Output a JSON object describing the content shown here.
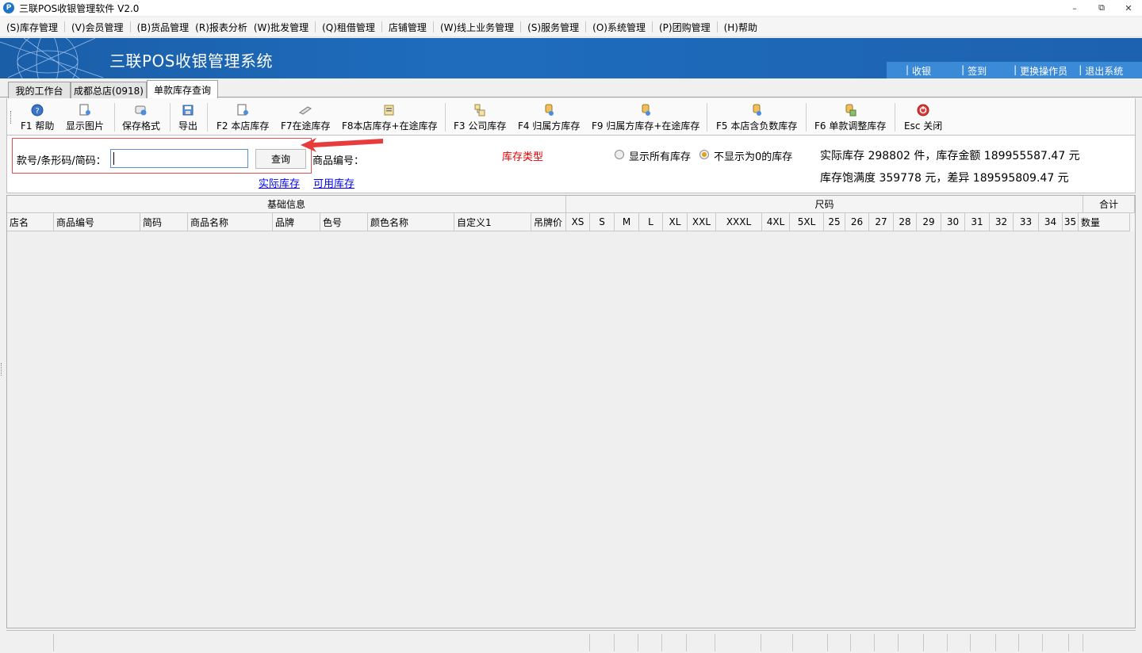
{
  "window": {
    "title": "三联POS收银管理软件 V2.0",
    "app_icon_letter": "P",
    "controls": {
      "minimize": "–",
      "restore": "⧉",
      "close": "✕"
    }
  },
  "menu": [
    "(S)库存管理",
    "(V)会员管理",
    "(B)货品管理",
    "(R)报表分析",
    "(W)批发管理",
    "(Q)租借管理",
    "店铺管理",
    "(W)线上业务管理",
    "(S)服务管理",
    "(O)系统管理",
    "(P)团购管理",
    "(H)帮助"
  ],
  "banner": {
    "title": "三联POS收银管理系统",
    "links": [
      "收银",
      "签到",
      "更换操作员",
      "退出系统"
    ]
  },
  "tabs": [
    "我的工作台",
    "成都总店(0918)",
    "单款库存查询"
  ],
  "toolbar": [
    {
      "label": "F1 帮助",
      "icon": "help-icon"
    },
    {
      "label": "显示图片",
      "icon": "image-icon"
    },
    {
      "label": "保存格式",
      "icon": "save-format-icon"
    },
    {
      "label": "导出",
      "icon": "export-icon"
    },
    {
      "label": "F2 本店库存",
      "icon": "store-stock-icon"
    },
    {
      "label": "F7在途库存",
      "icon": "transit-icon"
    },
    {
      "label": "F8本店库存+在途库存",
      "icon": "store-transit-icon"
    },
    {
      "label": "F3 公司库存",
      "icon": "company-stock-icon"
    },
    {
      "label": "F4 归属方库存",
      "icon": "owner-stock-icon"
    },
    {
      "label": "F9 归属方库存+在途库存",
      "icon": "owner-transit-icon"
    },
    {
      "label": "F5 本店含负数库存",
      "icon": "negative-stock-icon"
    },
    {
      "label": "F6 单款调整库存",
      "icon": "adjust-stock-icon"
    },
    {
      "label": "Esc 关闭",
      "icon": "close-icon"
    }
  ],
  "search": {
    "label": "款号/条形码/简码：",
    "value": "",
    "query_button": "查询",
    "product_code_label": "商品编号：",
    "link_actual": "实际库存",
    "link_available": "可用库存"
  },
  "stock_type": {
    "label": "库存类型",
    "options": [
      {
        "label": "显示所有库存",
        "checked": false
      },
      {
        "label": "不显示为0的库存",
        "checked": true
      }
    ]
  },
  "summary": {
    "line1": "实际库存 298802 件，库存金额 189955587.47 元",
    "line2": "库存饱满度 359778 元，差异 189595809.47 元"
  },
  "grid": {
    "groups": [
      "基础信息",
      "尺码",
      "合计"
    ],
    "columns": [
      "店名",
      "商品编号",
      "简码",
      "商品名称",
      "品牌",
      "色号",
      "颜色名称",
      "自定义1",
      "吊牌价",
      "XS",
      "S",
      "M",
      "L",
      "XL",
      "XXL",
      "XXXL",
      "4XL",
      "5XL",
      "25",
      "26",
      "27",
      "28",
      "29",
      "30",
      "31",
      "32",
      "33",
      "34",
      "35",
      "数量"
    ],
    "rows": []
  },
  "colors": {
    "banner": "#1f6cbd",
    "highlight_border": "#e05050",
    "stock_type_label": "#e00000",
    "link": "#0000ee"
  }
}
